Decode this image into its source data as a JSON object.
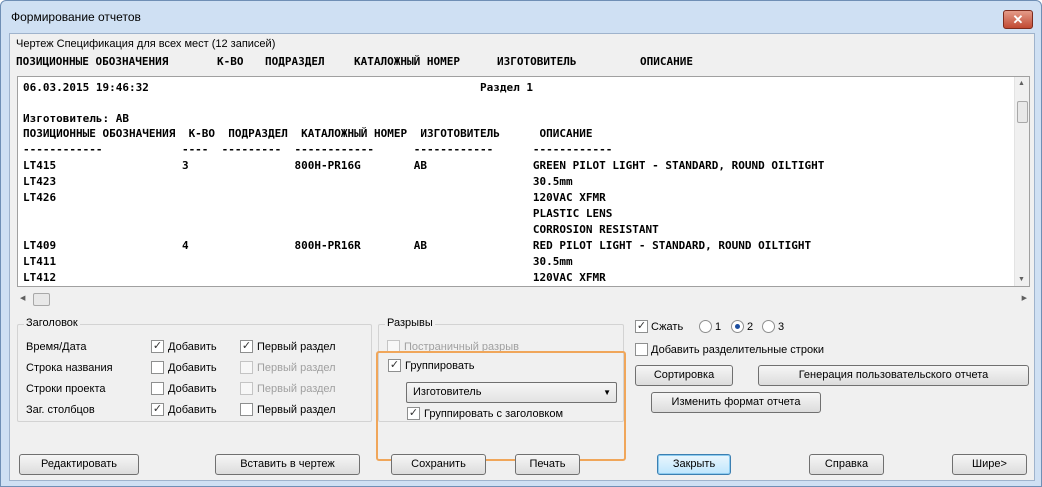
{
  "window": {
    "title": "Формирование отчетов",
    "close_label": "✕"
  },
  "subtitle": "Чертеж Спецификация для всех мест (12 записей)",
  "columns": [
    "ПОЗИЦИОННЫЕ ОБОЗНАЧЕНИЯ",
    "К-ВО",
    "ПОДРАЗДЕЛ",
    "КАТАЛОЖНЫЙ НОМЕР",
    "ИЗГОТОВИТЕЛЬ",
    "ОПИСАНИЕ"
  ],
  "preview": {
    "lines": [
      "06.03.2015 19:46:32                                                  Раздел 1",
      "",
      "Изготовитель: AB",
      "ПОЗИЦИОННЫЕ ОБОЗНАЧЕНИЯ  К-ВО  ПОДРАЗДЕЛ  КАТАЛОЖНЫЙ НОМЕР  ИЗГОТОВИТЕЛЬ      ОПИСАНИЕ",
      "------------            ----  ---------  ------------      ------------      ------------",
      "LT415                   3                800H-PR16G        AB                GREEN PILOT LIGHT - STANDARD, ROUND OILTIGHT",
      "LT423                                                                        30.5mm",
      "LT426                                                                        120VAC XFMR",
      "                                                                             PLASTIC LENS",
      "                                                                             CORROSION RESISTANT",
      "LT409                   4                800H-PR16R        AB                RED PILOT LIGHT - STANDARD, ROUND OILTIGHT",
      "LT411                                                                        30.5mm",
      "LT412                                                                        120VAC XFMR"
    ]
  },
  "header_group": {
    "title": "Заголовок",
    "rows": [
      {
        "label": "Время/Дата",
        "add_label": "Добавить",
        "add_checked": true,
        "first_label": "Первый раздел",
        "first_checked": true,
        "first_disabled": false
      },
      {
        "label": "Строка названия",
        "add_label": "Добавить",
        "add_checked": false,
        "first_label": "Первый раздел",
        "first_checked": false,
        "first_disabled": true
      },
      {
        "label": "Строки проекта",
        "add_label": "Добавить",
        "add_checked": false,
        "first_label": "Первый раздел",
        "first_checked": false,
        "first_disabled": true
      },
      {
        "label": "Заг. столбцов",
        "add_label": "Добавить",
        "add_checked": true,
        "first_label": "Первый раздел",
        "first_checked": false,
        "first_disabled": false
      }
    ]
  },
  "breaks_group": {
    "title": "Разрывы",
    "page_break_label": "Постраничный разрыв",
    "group_label": "Группировать",
    "group_by_value": "Изготовитель",
    "group_with_header_label": "Группировать с заголовком"
  },
  "right_panel": {
    "compress_label": "Сжать",
    "radio_options": [
      "1",
      "2",
      "3"
    ],
    "radio_selected": "2",
    "add_separator_label": "Добавить разделительные строки",
    "sort_button": "Сортировка",
    "custom_report_button": "Генерация пользовательского отчета",
    "change_format_button": "Изменить формат отчета"
  },
  "bottom_buttons": {
    "edit": "Редактировать",
    "insert": "Вставить в чертеж",
    "save": "Сохранить",
    "print": "Печать",
    "close": "Закрыть",
    "help": "Справка",
    "wider": "Шире>"
  }
}
